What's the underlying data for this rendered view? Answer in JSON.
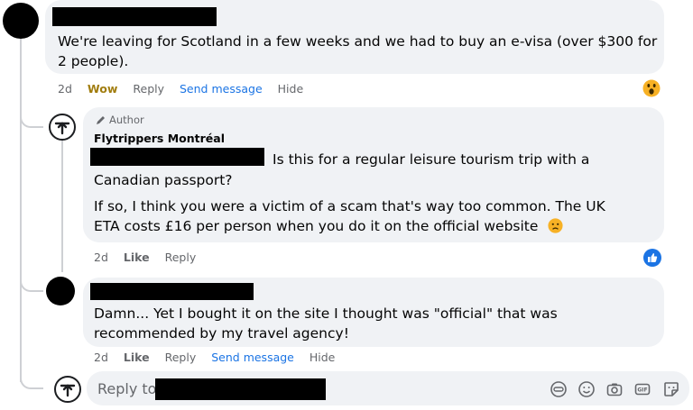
{
  "comments": [
    {
      "text": "We're leaving for Scotland in a few weeks and we had to buy an e-visa (over $300 for 2 people).",
      "actions": {
        "time": "2d",
        "reaction": "Wow",
        "reply": "Reply",
        "send": "Send message",
        "hide": "Hide"
      },
      "reaction_emoji": "wow-emoji"
    },
    {
      "author_tag": "Author",
      "author_name": "Flytrippers Montréal",
      "text_line1": "Is this for a regular leisure tourism trip with a",
      "text_line2": "Canadian passport?",
      "text_para2": "If so, I think you were a victim of a scam that's way too common. The UK ETA costs £16 per person when you do it on the official website",
      "actions": {
        "time": "2d",
        "like": "Like",
        "reply": "Reply"
      },
      "reaction_emoji": "like-icon"
    },
    {
      "text": "Damn... Yet I bought it on the site I thought was \"official\" that was recommended by my travel agency!",
      "actions": {
        "time": "2d",
        "like": "Like",
        "reply": "Reply",
        "send": "Send message",
        "hide": "Hide"
      }
    }
  ],
  "compose": {
    "placeholder": "Reply to",
    "icons": [
      "avatar-sticker-icon",
      "emoji-icon",
      "camera-icon",
      "gif-icon",
      "sticker-icon"
    ]
  },
  "colors": {
    "link_blue": "#1b74e4",
    "wow_gold": "#a17d0e",
    "bubble_bg": "#f0f2f5",
    "meta_gray": "#65676b"
  }
}
